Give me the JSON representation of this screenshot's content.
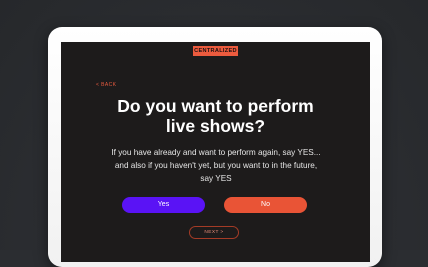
{
  "brand": {
    "logo_text": "CENTRALIZED"
  },
  "nav": {
    "back_label": "< BACK",
    "next_label": "NEXT >"
  },
  "question": {
    "title_line1": "Do you want to perform",
    "title_line2": "live shows?",
    "description_line1": "If you have already and want to perform again, say YES...",
    "description_line2": "and also if you haven't yet, but you want to in the future,",
    "description_line3": "say YES"
  },
  "answers": {
    "yes_label": "Yes",
    "no_label": "No"
  },
  "colors": {
    "accent": "#ec5b3e",
    "yes_button": "#5a13f5",
    "no_button": "#e95436",
    "screen_background": "#1d1b1b",
    "page_background": "#2b2d31"
  }
}
